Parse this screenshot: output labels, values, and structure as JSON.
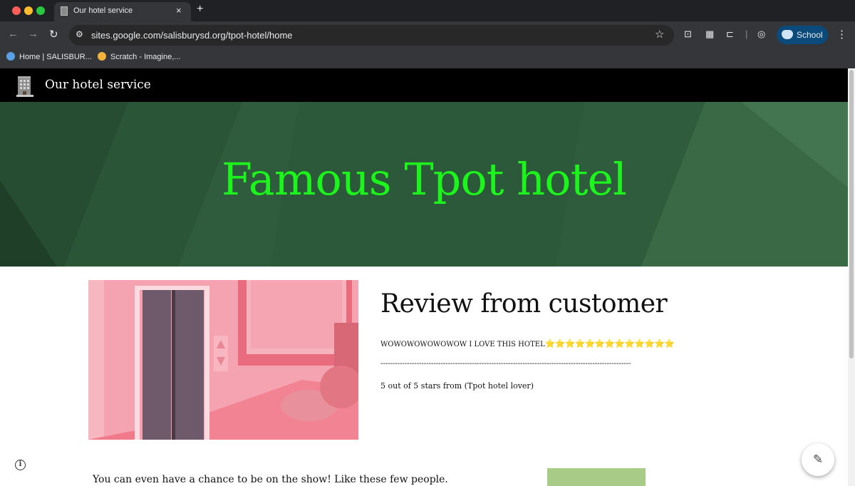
{
  "browser": {
    "tab_title": "Our hotel service",
    "close_glyph": "×",
    "new_tab_glyph": "+",
    "url": "sites.google.com/salisburysd.org/tpot-hotel/home",
    "profile_label": "School",
    "bookmarks": [
      {
        "label": "Home | SALISBUR...",
        "icon": "school-district-icon",
        "color": "#5aa0e6"
      },
      {
        "label": "Scratch - Imagine,...",
        "icon": "scratch-icon",
        "color": "#f2b33d"
      }
    ]
  },
  "site": {
    "name": "Our hotel service",
    "hero_title": "Famous Tpot hotel",
    "hero_color": "#1df41d",
    "review_title": "Review from customer",
    "review_text": "WOWOWOWOWOWOW I LOVE THIS HOTEL",
    "review_stars": "⭐⭐⭐⭐⭐⭐⭐⭐⭐⭐⭐⭐⭐",
    "divider": "------------------------------------------------------------------------------------------------------------",
    "rating_text": "5 out of 5 stars from (Tpot hotel lover)",
    "bottom_text": "You can even have a chance to be on the show! Like these few people."
  }
}
